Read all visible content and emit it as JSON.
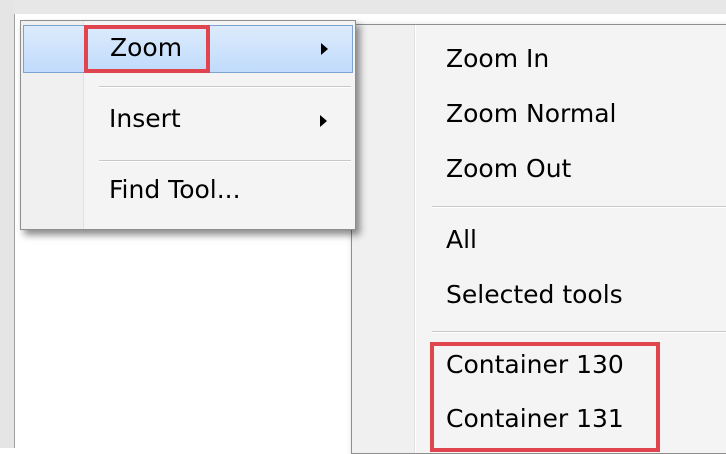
{
  "context_menu": {
    "items": [
      {
        "label": "Zoom",
        "has_submenu": true,
        "active": true
      },
      {
        "label": "Insert",
        "has_submenu": true,
        "active": false
      },
      {
        "label": "Find Tool...",
        "has_submenu": false,
        "active": false
      }
    ]
  },
  "zoom_submenu": {
    "items": [
      {
        "label": "Zoom In"
      },
      {
        "label": "Zoom Normal"
      },
      {
        "label": "Zoom Out"
      },
      {
        "label": "All"
      },
      {
        "label": "Selected tools"
      },
      {
        "label": "Container 130"
      },
      {
        "label": "Container 131"
      }
    ]
  },
  "colors": {
    "highlight_box": "#e0454f",
    "active_item_fill": "#c1dbfc",
    "active_item_border": "#7da2ce",
    "menu_background": "#f4f4f4"
  }
}
